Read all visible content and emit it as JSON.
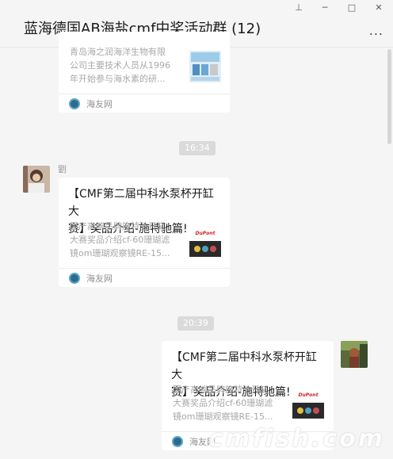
{
  "window": {
    "title": "蓝海德国AB海盐cmf中奖活动群 (12)",
    "controls": {
      "pin": "⊥",
      "minimize": "─",
      "maximize": "□",
      "close": "✕"
    },
    "more": "..."
  },
  "messages": {
    "card0": {
      "desc_lines": [
        "青岛海之润海洋生物有限",
        "公司主要技术人员从1996",
        "年开始参与海水素的研..."
      ],
      "source": "海友网"
    },
    "time1": "16:34",
    "card1": {
      "sender": "劉",
      "title_lines": [
        "【CMF第二届中科水泵杯开缸大",
        "赛】奖品介绍-施特驰篇!"
      ],
      "desc_lines": [
        "国产高端品牌施特驰开缸",
        "大赛奖品介绍cf-60珊瑚滤",
        "镜om珊瑚观察镜RE-15..."
      ],
      "thumb_brand": "DuPont",
      "source": "海友网"
    },
    "time2": "20:39",
    "card2": {
      "title_lines": [
        "【CMF第二届中科水泵杯开缸大",
        "赛】奖品介绍-施特驰篇!"
      ],
      "desc_lines": [
        "国产高端品牌施特驰开缸",
        "大赛奖品介绍cf-60珊瑚滤",
        "镜om珊瑚观察镜RE-15..."
      ],
      "thumb_brand": "DuPont",
      "source": "海友网"
    }
  },
  "watermark": "cmfish.com"
}
